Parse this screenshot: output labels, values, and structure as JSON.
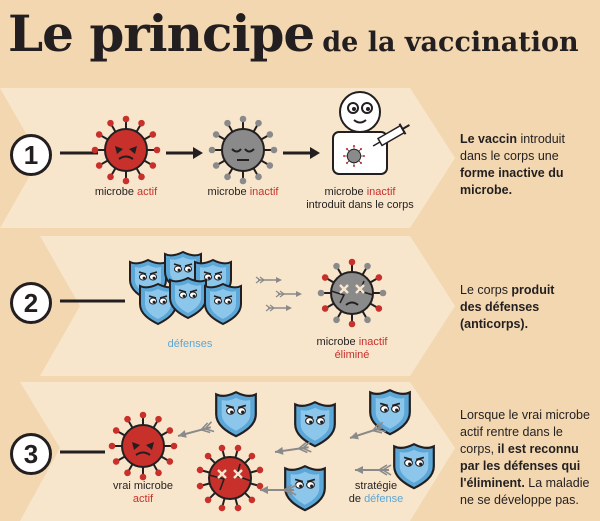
{
  "title": {
    "main": "Le principe",
    "sub": "de la vaccination"
  },
  "colors": {
    "background": "#f2d7b0",
    "band": "#f8e6cc",
    "red": "#c8302c",
    "grey": "#8a8a8a",
    "blue": "#5aa7d8",
    "dark": "#231f20"
  },
  "step1": {
    "number": "1",
    "caption_a_prefix": "microbe ",
    "caption_a_colored": "actif",
    "caption_b_prefix": "microbe ",
    "caption_b_colored": "inactif",
    "caption_c_line1_prefix": "microbe ",
    "caption_c_line1_colored": "inactif",
    "caption_c_line2": "introduit dans le corps",
    "desc_bold1": "Le vaccin",
    "desc_text1": " introduit dans le corps une ",
    "desc_bold2": "forme inactive du microbe."
  },
  "step2": {
    "number": "2",
    "caption_a": "défenses",
    "caption_b_prefix": "microbe ",
    "caption_b_colored": "inactif",
    "caption_b_line2": "éliminé",
    "desc_text1": "Le corps ",
    "desc_bold1": "produit",
    "desc_bold2": "des défenses (anticorps)."
  },
  "step3": {
    "number": "3",
    "caption_a_line1": "vrai microbe",
    "caption_a_line2": "actif",
    "caption_b_line1": "stratégie",
    "caption_b_line2_prefix": "de ",
    "caption_b_line2_colored": "défense",
    "desc_text1": "Lorsque le vrai microbe actif rentre dans le corps, ",
    "desc_bold1": "il est reconnu par les défenses qui l'éliminent.",
    "desc_text2": " La maladie ne se développe pas."
  }
}
